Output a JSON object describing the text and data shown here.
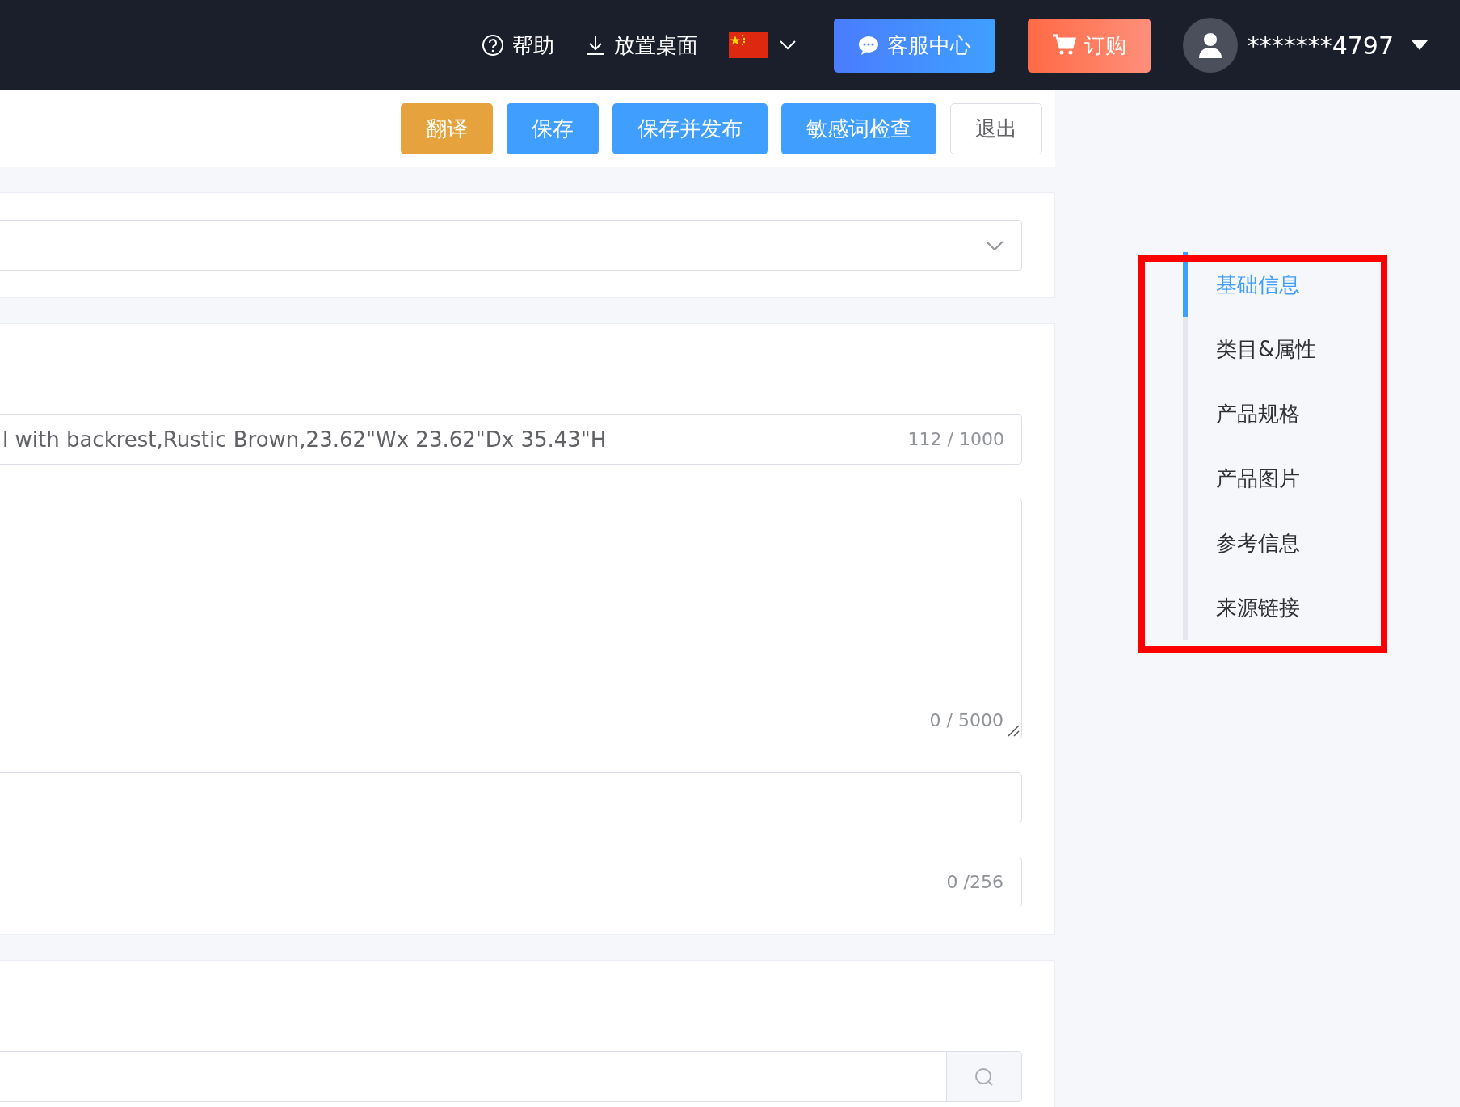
{
  "header": {
    "help": "帮助",
    "desktop": "放置桌面",
    "service": "客服中心",
    "order": "订购",
    "user": "*******4797"
  },
  "toolbar": {
    "buttons": [
      {
        "label": "翻译",
        "kind": "warning"
      },
      {
        "label": "保存",
        "kind": "primary"
      },
      {
        "label": "保存并发布",
        "kind": "primary"
      },
      {
        "label": "敏感词检查",
        "kind": "primary"
      },
      {
        "label": "退出",
        "kind": "plain"
      }
    ]
  },
  "form": {
    "title_value": "l with backrest,Rustic Brown,23.62\"Wx 23.62\"Dx 35.43\"H",
    "title_count": "112 / 1000",
    "description_count": "0 / 5000",
    "keywords_count": "0 /256"
  },
  "anchor_nav": {
    "items": [
      {
        "label": "基础信息",
        "selected": true
      },
      {
        "label": "类目&属性",
        "selected": false
      },
      {
        "label": "产品规格",
        "selected": false
      },
      {
        "label": "产品图片",
        "selected": false
      },
      {
        "label": "参考信息",
        "selected": false
      },
      {
        "label": "来源链接",
        "selected": false
      }
    ]
  }
}
